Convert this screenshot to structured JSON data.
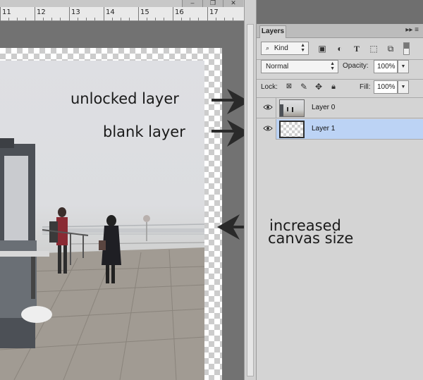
{
  "ruler": {
    "labels": [
      "11",
      "12",
      "13",
      "14",
      "15",
      "16",
      "17"
    ]
  },
  "window_controls": {
    "minimize": "–",
    "restore": "❐",
    "close": "✕"
  },
  "panel": {
    "tab": "Layers",
    "menu_glyph": "▸▸ ≡",
    "filter": {
      "kind_label": "Kind",
      "search_icon": "magnifier-icon"
    },
    "blend_mode": "Normal",
    "opacity_label": "Opacity:",
    "opacity_value": "100%",
    "lock_label": "Lock:",
    "fill_label": "Fill:",
    "fill_value": "100%",
    "layers": [
      {
        "name": "Layer 0",
        "selected": false
      },
      {
        "name": "Layer 1",
        "selected": true
      }
    ],
    "selection_color": "#bcd3f5"
  },
  "annotations": {
    "unlocked": "unlocked layer",
    "blank": "blank layer",
    "canvas_line1": "increased",
    "canvas_line2": "canvas size"
  }
}
